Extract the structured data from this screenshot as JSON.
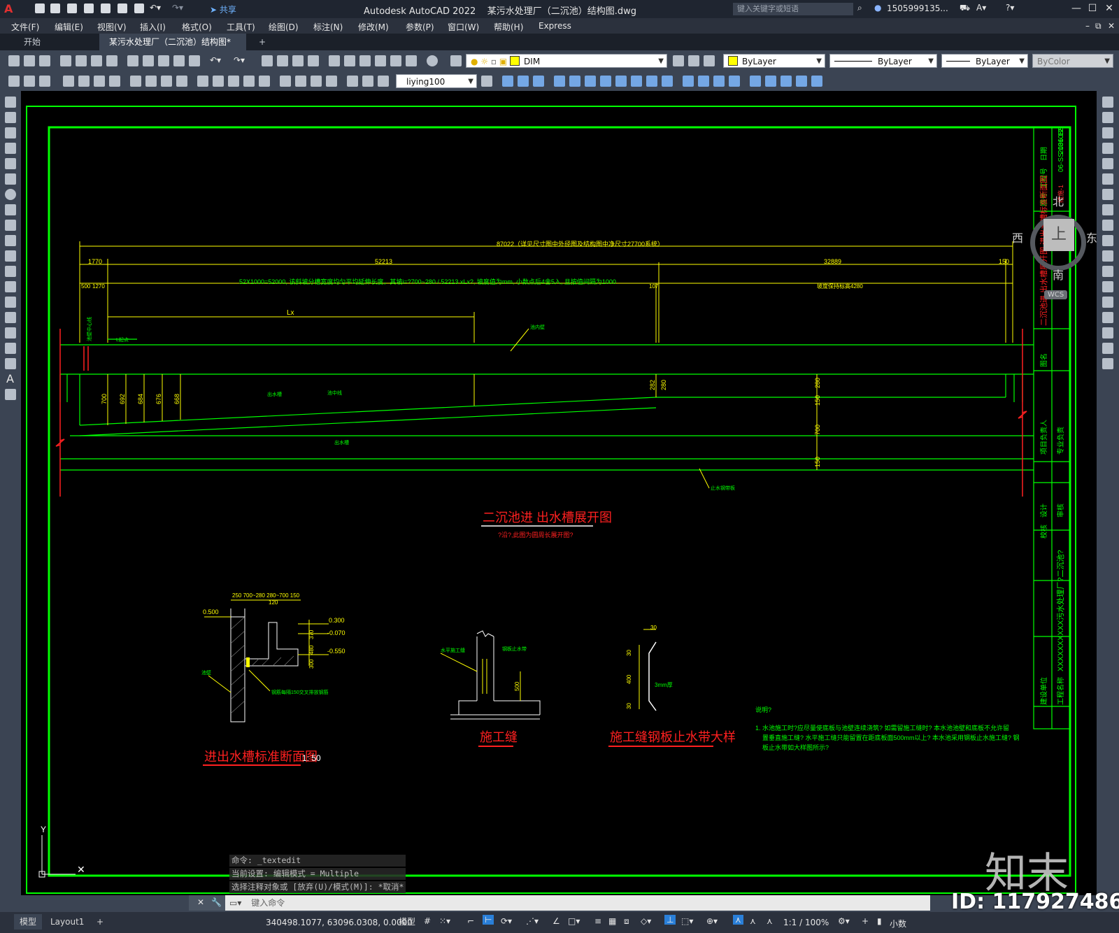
{
  "title_bar": {
    "app_title": "Autodesk AutoCAD 2022",
    "file_title": "某污水处理厂（二沉池）结构图.dwg",
    "share_label": "共享",
    "search_placeholder": "键入关键字或短语",
    "user": "1505999135..."
  },
  "menu": [
    "文件(F)",
    "编辑(E)",
    "视图(V)",
    "插入(I)",
    "格式(O)",
    "工具(T)",
    "绘图(D)",
    "标注(N)",
    "修改(M)",
    "参数(P)",
    "窗口(W)",
    "帮助(H)",
    "Express"
  ],
  "tabs": [
    {
      "label": "开始"
    },
    {
      "label": "某污水处理厂（二沉池）结构图*"
    }
  ],
  "toolbar": {
    "layer": "DIM",
    "color": "ByLayer",
    "linetype": "ByLayer",
    "lineweight": "ByLayer",
    "plotstyle": "ByColor",
    "dimstyle": "liying100"
  },
  "viewcube": {
    "north": "北",
    "south": "南",
    "west": "西",
    "east": "东",
    "face": "上",
    "wcs": "WCS"
  },
  "drawing": {
    "dims": {
      "total": "87022（详见尺寸图中外径图及结构图中净尺寸27700系统）",
      "d1770": "1770",
      "d52213": "52213",
      "d32889": "32889",
      "d150": "150",
      "d500": "500",
      "d1270": "1270",
      "slope_note": "52X1000=52000, 该斜坡分槽宽度均匀平均延伸长度，其坡i=?700~280 / 52213 xLx?, 坡度值为mm, 小数点后4舍5入, 且按值间隔为1000",
      "note_1000": "1000",
      "d107": "107",
      "lx": "Lx",
      "d700a": "700",
      "d692": "692",
      "d684": "684",
      "d676": "676",
      "d668": "668",
      "d282": "282",
      "d280": "280",
      "d280b": "280",
      "d150a": "150",
      "d700b": "700",
      "d150b": "150",
      "right_note": "坡度保持标高4280"
    },
    "labels": {
      "outlet": "出水槽",
      "inner_wall": "池内壁",
      "center": "池中线",
      "steel": "止水钢带板",
      "outlet_wall": "出水槽",
      "left_note": "池壁中心线",
      "left_small": "L起点"
    },
    "main_title": "二沉池进 出水槽展开图",
    "main_subtitle": "?沿?,此图为圆周长展开图?",
    "section": {
      "title": "进出水槽标准断面图",
      "scale": "1: 50",
      "top_dims": "250  700~280  280~700  150",
      "d120": "120",
      "el1": "0.500",
      "el2": "0.300",
      "el3": "-0.070",
      "el4": "-0.550",
      "v370": "370",
      "v480": "480",
      "v300": "300",
      "wall": "池壁",
      "note": "钢筋每隔150交叉排放钢筋"
    },
    "joint": {
      "title": "施工缝",
      "label1": "水平施工缝",
      "label2": "钢板止水带",
      "d500": "500"
    },
    "waterstop": {
      "title": "施工缝钢板止水带大样",
      "d30a": "30",
      "d30b": "30",
      "d400": "400",
      "d30c": "30",
      "thick": "3mm厚"
    },
    "notes": {
      "heading": "说明?",
      "line1": "1. 水池施工时?应尽量使底板与池壁连续浇筑? 如需留施工缝时? 本水池池壁和底板不允许留",
      "line2": "置垂直施工缝? 水平施工缝只能留置在距底板面500mm以上? 本水池采用钢板止水施工缝? 钢",
      "line3": "板止水带如大样图所示?"
    },
    "titleblock": {
      "project_no_label": "工程号",
      "drawing_no_label": "图号",
      "date_label": "日期",
      "project_no": "06-SS-131088",
      "drawing_no": "结施-1",
      "date": "2006.12",
      "drawing_name": "二沉池进 出水槽展开图 进出水槽标准断面图",
      "name_label": "图名",
      "manager_label": "项目负责人",
      "pro_manager_label": "专业负责",
      "design_label": "设计",
      "check_label": "校核",
      "review_label": "审核",
      "project_name": "XXXXXXXXXX污水处理厂?二沉池?",
      "client_label": "建设单位",
      "project_label": "工程名称"
    }
  },
  "command": {
    "history": [
      "命令: _textedit",
      "当前设置: 编辑模式 = Multiple",
      "选择注释对象或 [放弃(U)/模式(M)]: *取消*"
    ],
    "placeholder": "键入命令"
  },
  "status": {
    "model_tab": "模型",
    "layout_tab": "Layout1",
    "coords": "340498.1077, 63096.0308, 0.0000",
    "mode": "模型",
    "scale": "1:1 / 100%",
    "units": "小数"
  },
  "brand": {
    "logo": "知末",
    "id": "ID: 1179274860"
  },
  "colors": {
    "frame": "#00ff00",
    "dim": "#ffff00",
    "title": "#ff0000",
    "background": "#000000"
  }
}
